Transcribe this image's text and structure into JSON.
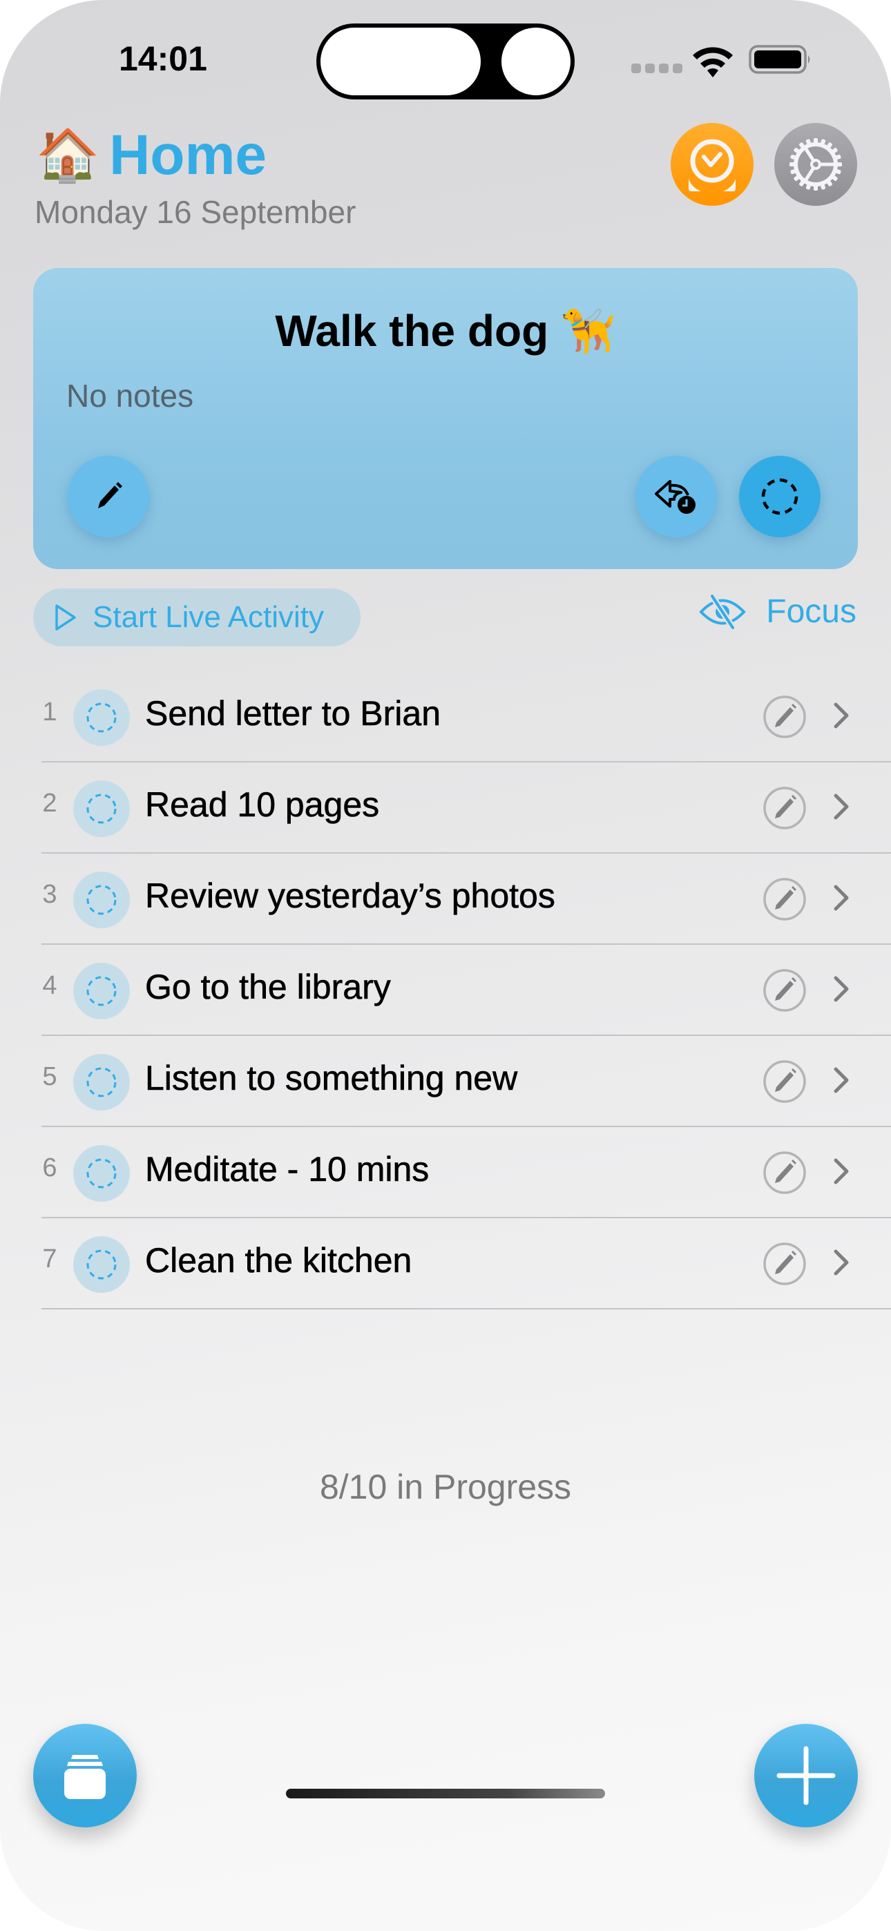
{
  "status_bar": {
    "time": "14:01",
    "icons": [
      "cellular-signal-icon",
      "wifi-icon",
      "battery-icon"
    ]
  },
  "header": {
    "emoji": "🏠",
    "title": "Home",
    "date": "Monday 16 September",
    "buttons": [
      {
        "name": "alarm-button",
        "icon": "alarm-clock-icon",
        "color": "#ff9f0a"
      },
      {
        "name": "settings-button",
        "icon": "gear-icon",
        "color": "#98989d"
      }
    ]
  },
  "current_task": {
    "title": "Walk the dog 🦮",
    "notes": "No notes",
    "actions": [
      {
        "name": "edit-button",
        "icon": "pencil-icon"
      },
      {
        "name": "snooze-button",
        "icon": "arrow-back-clock-icon"
      },
      {
        "name": "complete-button",
        "icon": "dashed-circle-icon"
      }
    ]
  },
  "actions": {
    "live_activity_label": "Start Live Activity",
    "focus_label": "Focus"
  },
  "tasks": [
    {
      "number": "1",
      "title": "Send letter to Brian"
    },
    {
      "number": "2",
      "title": "Read 10 pages"
    },
    {
      "number": "3",
      "title": "Review yesterday’s photos"
    },
    {
      "number": "4",
      "title": "Go to the library"
    },
    {
      "number": "5",
      "title": "Listen to something new"
    },
    {
      "number": "6",
      "title": "Meditate - 10 mins"
    },
    {
      "number": "7",
      "title": "Clean the kitchen"
    }
  ],
  "progress": {
    "label": "8/10 in Progress",
    "done": 8,
    "total": 10
  },
  "bottom_bar": {
    "left_button_icon": "stacked-cards-icon",
    "right_button_icon": "plus-icon"
  },
  "colors": {
    "accent": "#33ace6",
    "card": "#8ec7e5",
    "orange": "#ff9f0a",
    "gray_button": "#98989d"
  }
}
